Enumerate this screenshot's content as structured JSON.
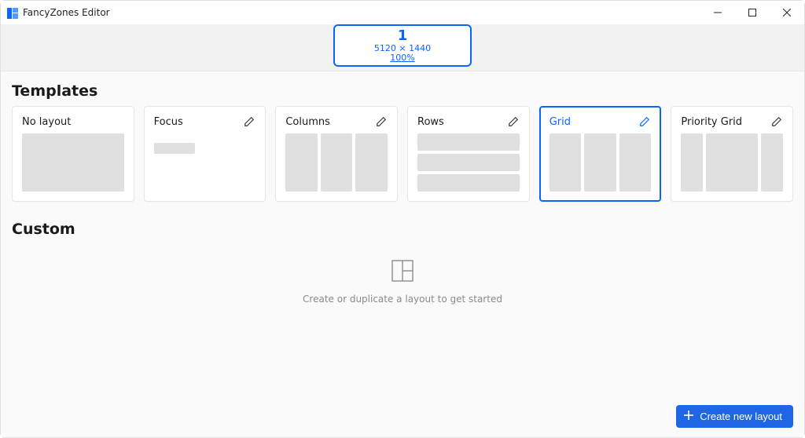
{
  "window": {
    "title": "FancyZones Editor"
  },
  "monitor": {
    "index": "1",
    "resolution": "5120 × 1440",
    "scale": "100%"
  },
  "sections": {
    "templates_heading": "Templates",
    "custom_heading": "Custom"
  },
  "templates": {
    "no_layout": "No layout",
    "focus": "Focus",
    "columns": "Columns",
    "rows": "Rows",
    "grid": "Grid",
    "priority_grid": "Priority Grid",
    "selected": "grid"
  },
  "custom": {
    "empty_message": "Create or duplicate a layout to get started"
  },
  "buttons": {
    "create_new_layout": "Create new layout"
  }
}
